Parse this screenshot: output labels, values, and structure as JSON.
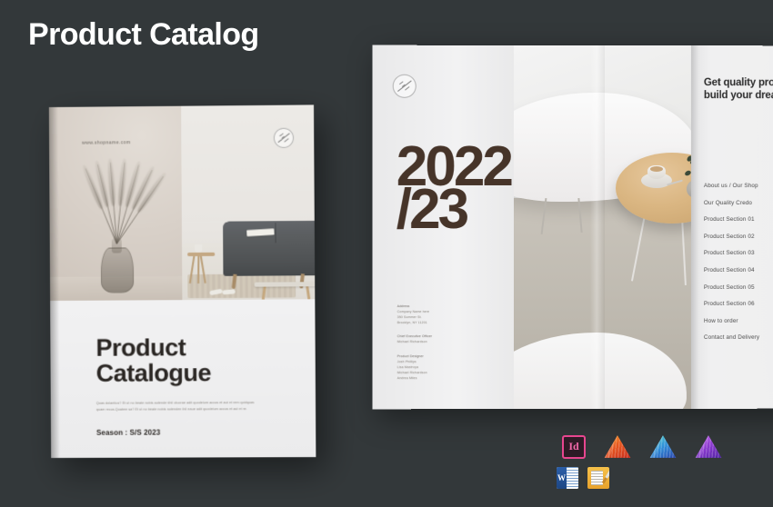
{
  "header": {
    "title": "Product Catalog"
  },
  "theme": {
    "background": "#33383a",
    "title_color": "#ffffff",
    "heading_color": "#2b2724",
    "year_color": "#463429",
    "muted_text": "#86817b"
  },
  "cover": {
    "url": "www.shopname.com",
    "badge": "logo-badge",
    "heading_line1": "Product",
    "heading_line2": "Catalogue",
    "body": "Quas dolantius? Et ut no beate nobis autendenihil oluorae adit quodeium accus et aut et rem quidquas quam recus.Quatem sa? Et ut no beate nobis autenden ihil eaue adit quodeium accus et aut et re.",
    "season": "Season : S/S 2023"
  },
  "spread": {
    "year": "2022\n/23",
    "badge": "logo-badge",
    "headline_line1": "Get quality prod",
    "headline_line2": "build your drean",
    "contents": [
      "About us / Our Shop",
      "Our Quality Credo",
      "Product Section 01",
      "Product Section 02",
      "Product Section 03",
      "Product Section 04",
      "Product Section 05",
      "Product Section 06",
      "How to order",
      "Contact and Delivery"
    ],
    "info_blocks": [
      {
        "heading": "Address",
        "lines": [
          "Company Name here",
          "350 Summer St.",
          "Brooklyn, NY 11201"
        ]
      },
      {
        "heading": "Chief Executive Officer",
        "lines": [
          "Michael Richardson"
        ]
      },
      {
        "heading": "Product Designer",
        "lines": [
          "Josh Phillips",
          "Lisa Mastroya",
          "Michael Richardson",
          "Andrea Miles"
        ]
      }
    ]
  },
  "apps": {
    "row1": [
      {
        "name": "indesign",
        "label": "Id"
      },
      {
        "name": "affinity-designer",
        "label": ""
      },
      {
        "name": "affinity-photo",
        "label": ""
      },
      {
        "name": "affinity-publisher",
        "label": ""
      }
    ],
    "row2": [
      {
        "name": "microsoft-word",
        "label": "W"
      },
      {
        "name": "pages",
        "label": ""
      }
    ]
  }
}
